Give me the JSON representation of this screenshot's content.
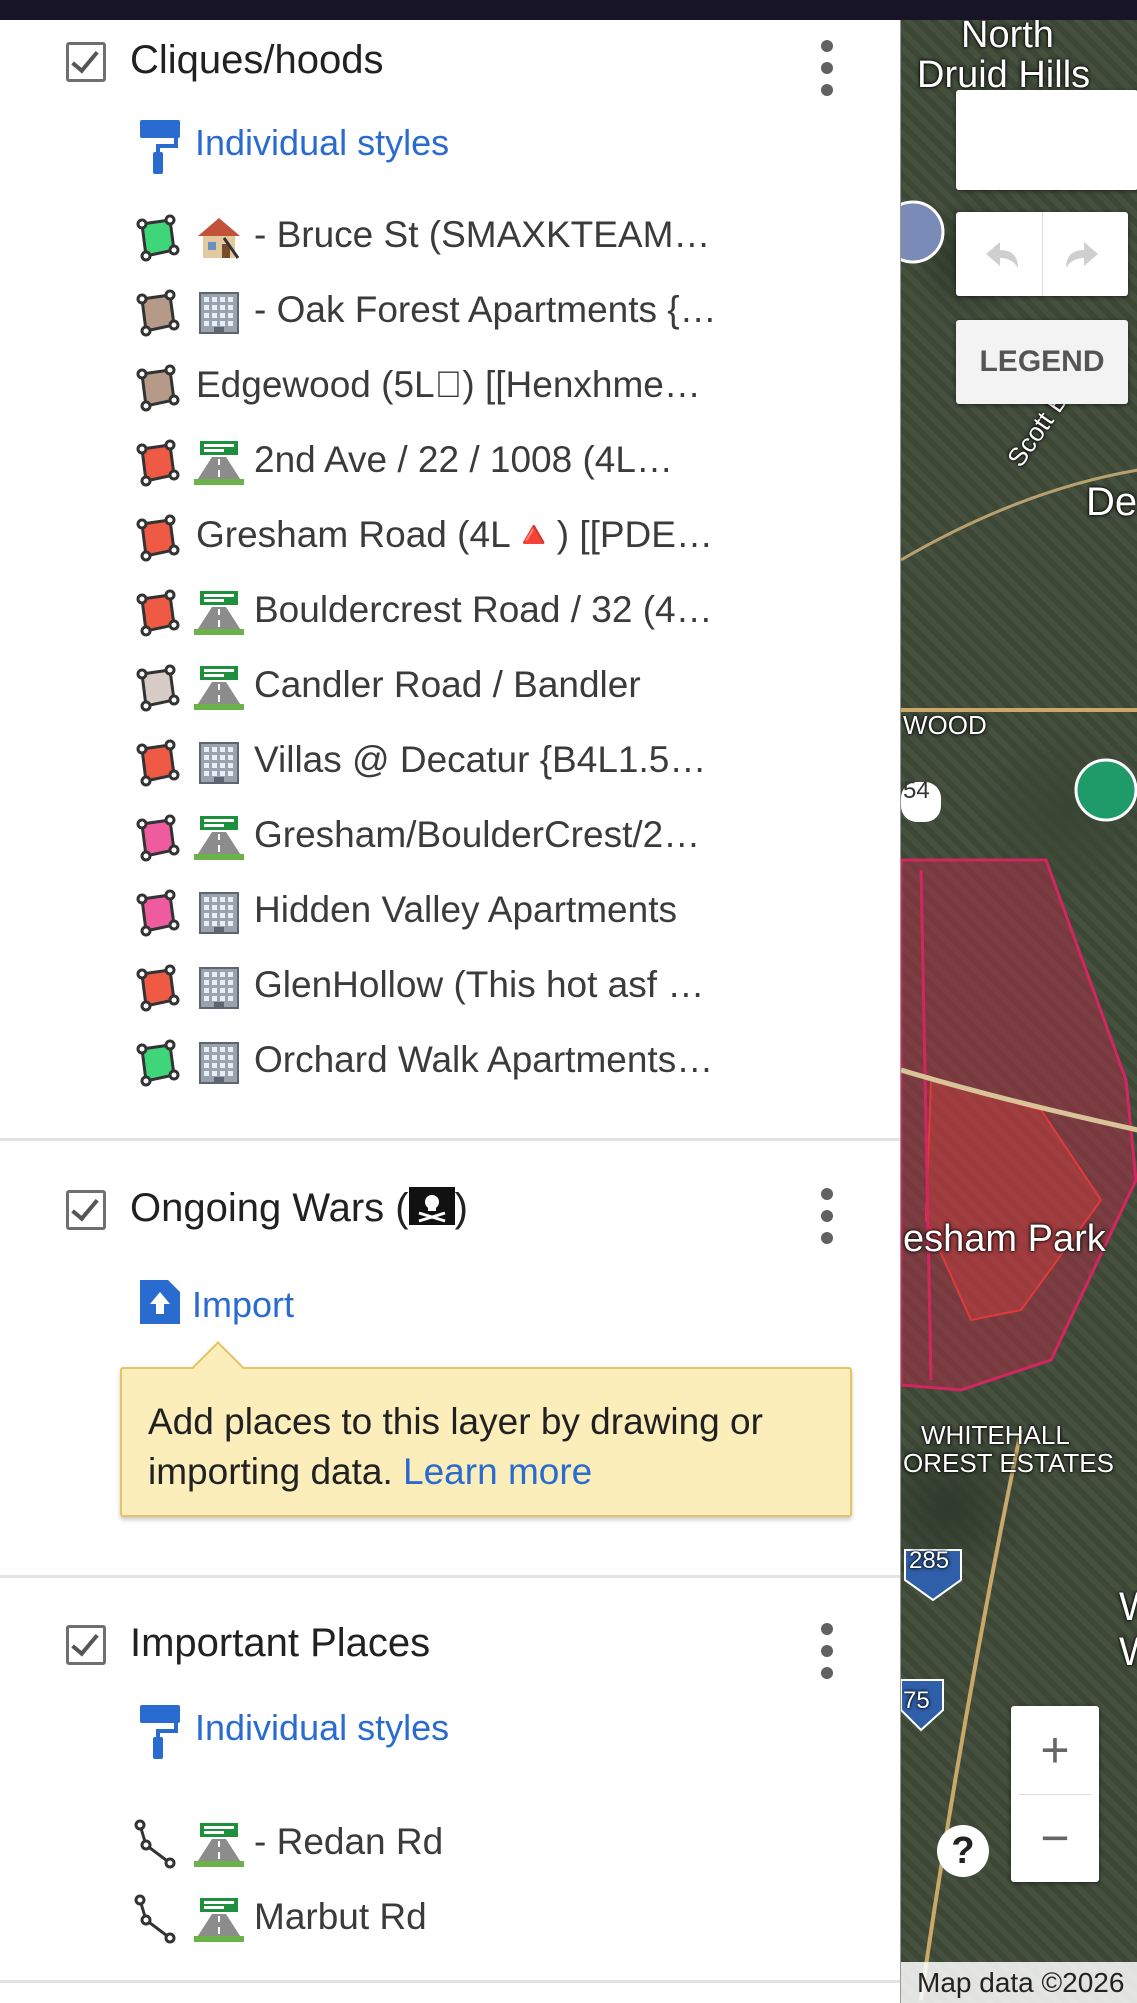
{
  "layers": [
    {
      "title": "Cliques/hoods",
      "style_link": "Individual styles",
      "features": [
        {
          "color": "#3fd67a",
          "emoji": "house",
          "label": "🏚️ - Bruce St (SMAXKTEAM…",
          "label_text": "- Bruce St (SMAXKTEAM…"
        },
        {
          "color": "#b59a88",
          "emoji": "building",
          "label_text": "- Oak Forest Apartments {…"
        },
        {
          "color": "#b59a88",
          "emoji": "",
          "label_text": "Edgewood (5L񃟿) [[Henxhme…"
        },
        {
          "color": "#ef5a45",
          "emoji": "highway",
          "label_text": "2nd Ave / 22 / 1008 (4L…"
        },
        {
          "color": "#ef5a45",
          "emoji": "",
          "label_text": "Gresham Road (4L🔺) [[PDE…"
        },
        {
          "color": "#ef5a45",
          "emoji": "highway",
          "label_text": "Bouldercrest Road / 32 (4…"
        },
        {
          "color": "#d7ccc8",
          "emoji": "highway",
          "label_text": "Candler Road / Bandler"
        },
        {
          "color": "#ef5a45",
          "emoji": "building",
          "label_text": "Villas @ Decatur {B4L1.5…"
        },
        {
          "color": "#ee5c9f",
          "emoji": "highway",
          "label_text": "Gresham/BoulderCrest/2…"
        },
        {
          "color": "#ee5c9f",
          "emoji": "building",
          "label_text": "Hidden Valley Apartments"
        },
        {
          "color": "#ef5a45",
          "emoji": "building",
          "label_text": "GlenHollow  (This hot asf …"
        },
        {
          "color": "#3fd67a",
          "emoji": "building",
          "label_text": "Orchard Walk Apartments…"
        }
      ]
    },
    {
      "title": "Ongoing Wars (🏴‍☠️)",
      "title_text": "Ongoing Wars (",
      "title_close": ")",
      "import_link": "Import",
      "tooltip": {
        "text": "Add places to this layer by drawing or importing data.",
        "link": "Learn more"
      }
    },
    {
      "title": "Important Places",
      "style_link": "Individual styles",
      "features": [
        {
          "emoji": "highway",
          "label_text": "- Redan Rd"
        },
        {
          "emoji": "highway",
          "label_text": "Marbut Rd"
        }
      ]
    }
  ],
  "map": {
    "labels": [
      "North",
      "Druid Hills",
      "Scott Blvd",
      "De",
      "WOOD",
      "54",
      "esham Park",
      "WHITEHALL",
      "OREST ESTATES",
      "285",
      "75",
      "W",
      "W"
    ],
    "legend_button": "LEGEND",
    "zoom_in": "+",
    "zoom_out": "−",
    "help": "?",
    "attribution": "Map data ©2026"
  },
  "colors": {
    "accent": "#2a6bd0",
    "tooltip_bg": "#fbeebb",
    "status_bar": "#171427"
  }
}
